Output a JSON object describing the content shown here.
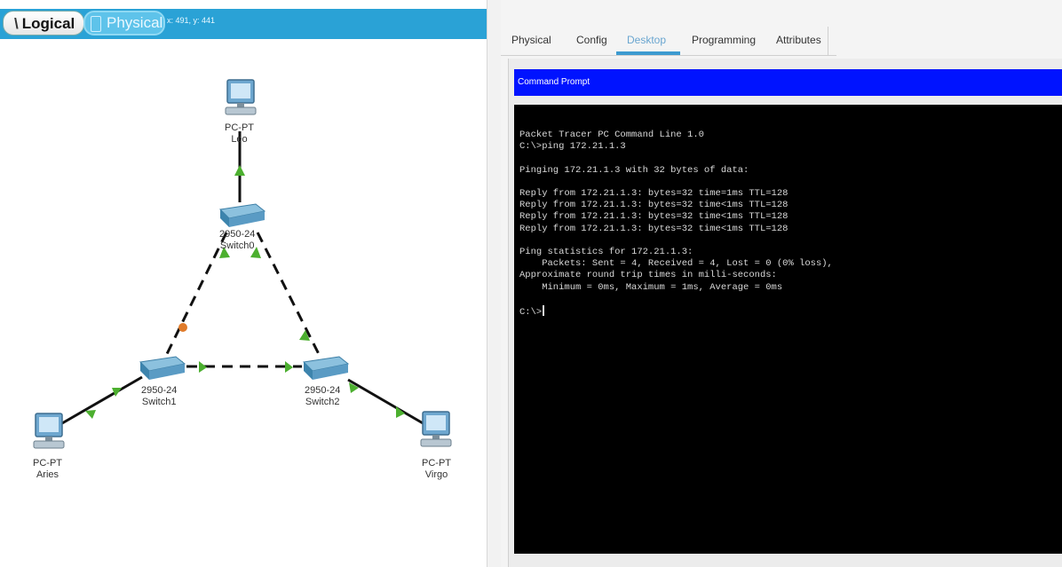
{
  "workspace": {
    "logical_label": "Logical",
    "physical_label": "Physical",
    "coordinates": "x: 491, y: 441"
  },
  "devices": {
    "pc_top": {
      "model": "PC-PT",
      "name": "Leo"
    },
    "switch0": {
      "model": "2950-24",
      "name": "Switch0"
    },
    "switch1": {
      "model": "2950-24",
      "name": "Switch1"
    },
    "switch2": {
      "model": "2950-24",
      "name": "Switch2"
    },
    "pc_left": {
      "model": "PC-PT",
      "name": "Aries"
    },
    "pc_right": {
      "model": "PC-PT",
      "name": "Virgo"
    }
  },
  "tabs": [
    "Physical",
    "Config",
    "Desktop",
    "Programming",
    "Attributes"
  ],
  "active_tab": "Desktop",
  "command_prompt": {
    "title": "Command Prompt",
    "output": "Packet Tracer PC Command Line 1.0\nC:\\>ping 172.21.1.3\n\nPinging 172.21.1.3 with 32 bytes of data:\n\nReply from 172.21.1.3: bytes=32 time=1ms TTL=128\nReply from 172.21.1.3: bytes=32 time<1ms TTL=128\nReply from 172.21.1.3: bytes=32 time<1ms TTL=128\nReply from 172.21.1.3: bytes=32 time<1ms TTL=128\n\nPing statistics for 172.21.1.3:\n    Packets: Sent = 4, Received = 4, Lost = 0 (0% loss),\nApproximate round trip times in milli-seconds:\n    Minimum = 0ms, Maximum = 1ms, Average = 0ms\n\n",
    "prompt": "C:\\>"
  },
  "colors": {
    "toolbar": "#2aa2d6",
    "link_up": "#4caf2f",
    "link_pending": "#e07b2a",
    "prompt_bar": "#0013ff",
    "console_bg": "#000000"
  }
}
